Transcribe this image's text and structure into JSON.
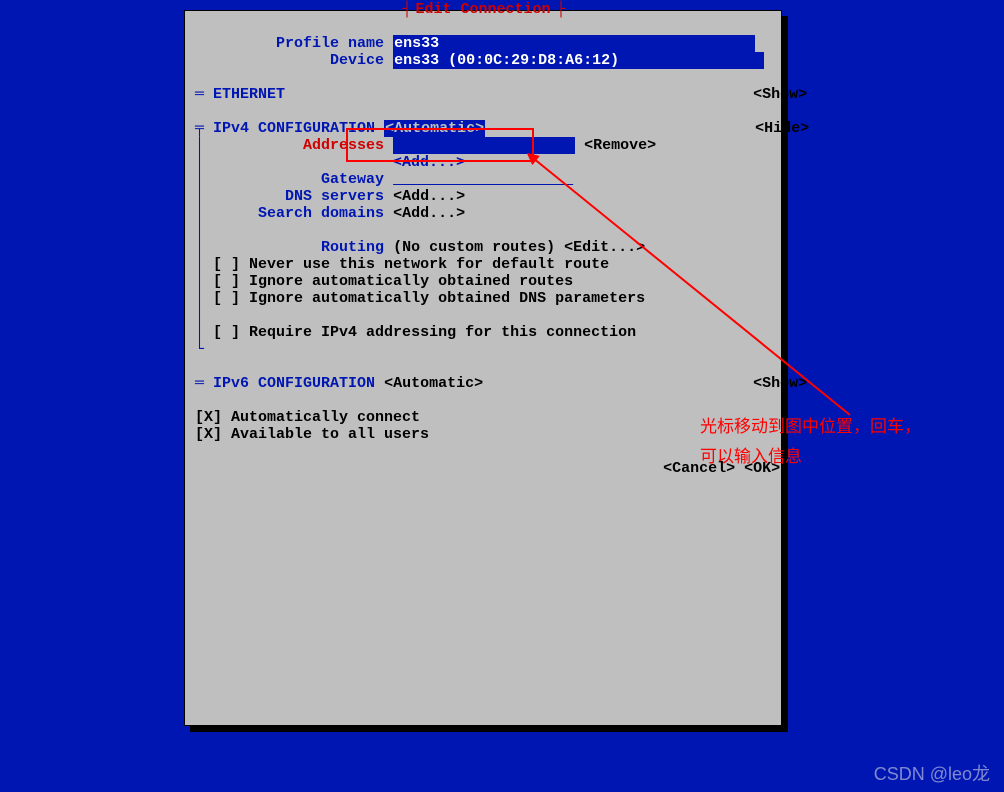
{
  "window": {
    "title": "Edit Connection",
    "title_bar": "┤",
    "title_bar2": "├"
  },
  "profile": {
    "name_lbl": "Profile name",
    "name_val": "ens33",
    "device_lbl": "Device",
    "device_val": "ens33 (00:0C:29:D8:A6:12)"
  },
  "ethernet": {
    "mark": "═",
    "heading": "ETHERNET",
    "action": "<Show>"
  },
  "ipv4": {
    "mark": "╤",
    "heading": "IPv4 CONFIGURATION",
    "mode": "<Automatic>",
    "action": "<Hide>",
    "vbar": "│",
    "addresses_lbl": "Addresses",
    "addresses_val": "",
    "addresses_remove": "<Remove>",
    "add": "<Add...>",
    "gateway_lbl": "Gateway",
    "gateway_val": "",
    "dns_lbl": "DNS servers",
    "search_lbl": "Search domains",
    "routing_lbl": "Routing",
    "routing_val": "(No custom routes)",
    "routing_edit": "<Edit...>",
    "cb1": "[ ] Never use this network for default route",
    "cb2": "[ ] Ignore automatically obtained routes",
    "cb3": "[ ] Ignore automatically obtained DNS parameters",
    "cb4": "[ ] Require IPv4 addressing for this connection",
    "end": "└"
  },
  "ipv6": {
    "mark": "═",
    "heading": "IPv6 CONFIGURATION",
    "mode": "<Automatic>",
    "action": "<Show>"
  },
  "opts": {
    "auto": "[X] Automatically connect",
    "users": "[X] Available to all users"
  },
  "footer": {
    "cancel": "<Cancel>",
    "ok": "<OK>"
  },
  "annotation": {
    "line1": "光标移动到图中位置，回车，",
    "line2": "可以输入信息"
  },
  "watermark": "CSDN @leo龙"
}
